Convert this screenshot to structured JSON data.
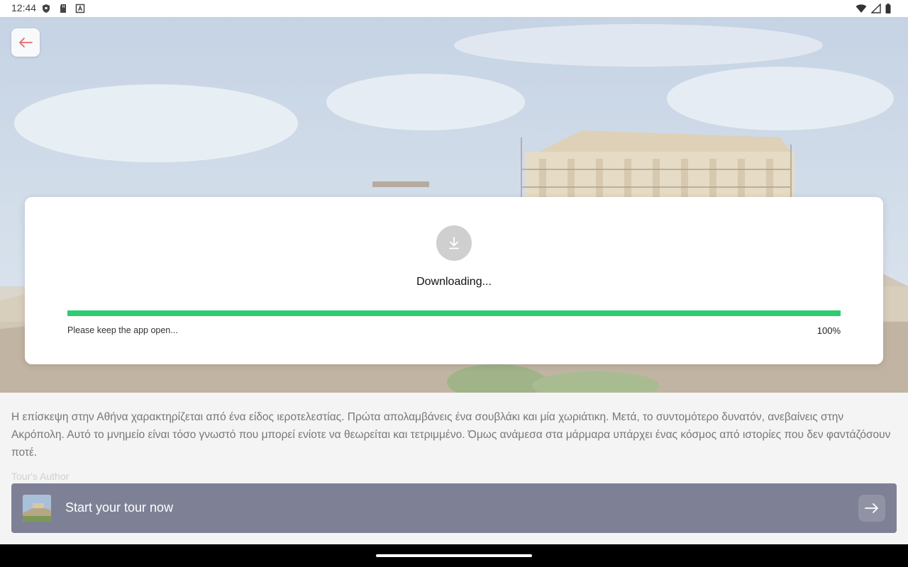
{
  "status_bar": {
    "time": "12:44",
    "left_icons": [
      "shield-icon",
      "sd-card-icon",
      "font-icon"
    ],
    "right_icons": [
      "wifi-icon",
      "signal-icon",
      "battery-icon"
    ]
  },
  "hero": {
    "back_icon": "arrow-left-icon",
    "accent_color": "#e36b6b"
  },
  "description": "Η επίσκεψη στην Αθήνα χαρακτηρίζεται από ένα είδος ιεροτελεστίας. Πρώτα απολαμβάνεις ένα σουβλάκι και μία χωριάτικη. Μετά, το συντομότερο δυνατόν, ανεβαίνεις στην Ακρόπολη. Αυτό το μνημείο είναι τόσο γνωστό που μπορεί ενίοτε να θεωρείται και τετριμμένο. Όμως ανάμεσα στα μάρμαρα υπάρχει ένας κόσμος από ιστορίες που δεν φαντάζόσουν ποτέ.",
  "author_label": "Tour's Author",
  "start_bar": {
    "label": "Start your tour now",
    "arrow_icon": "arrow-right-icon",
    "color": "#7e8196"
  },
  "download_modal": {
    "icon": "download-icon",
    "title": "Downloading...",
    "note": "Please keep the app open...",
    "percent_text": "100%",
    "progress": 1.0,
    "progress_color": "#2ecc71"
  }
}
